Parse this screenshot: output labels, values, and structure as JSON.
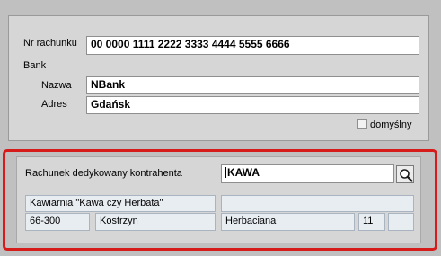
{
  "account": {
    "number_label": "Nr rachunku",
    "number_value": "00  0000 1111 2222 3333 4444 5555 6666"
  },
  "bank": {
    "section_label": "Bank",
    "name_label": "Nazwa",
    "name_value": "NBank",
    "address_label": "Adres",
    "address_value": "Gdańsk",
    "default_checkbox_label": "domyślny",
    "default_checked": false
  },
  "dedicated": {
    "label": "Rachunek dedykowany kontrahenta",
    "search_value": "KAWA",
    "search_icon": "magnifier-icon"
  },
  "contractor": {
    "name": "Kawiarnia \"Kawa czy Herbata\"",
    "extra": "",
    "postal_code": "66-300",
    "city": "Kostrzyn",
    "street": "Herbaciana",
    "house_number": "11",
    "apartment_number": ""
  },
  "colors": {
    "highlight_frame": "#d61b1b",
    "readonly_fill": "#e8edf2",
    "panel_bg": "#d6d6d6"
  }
}
